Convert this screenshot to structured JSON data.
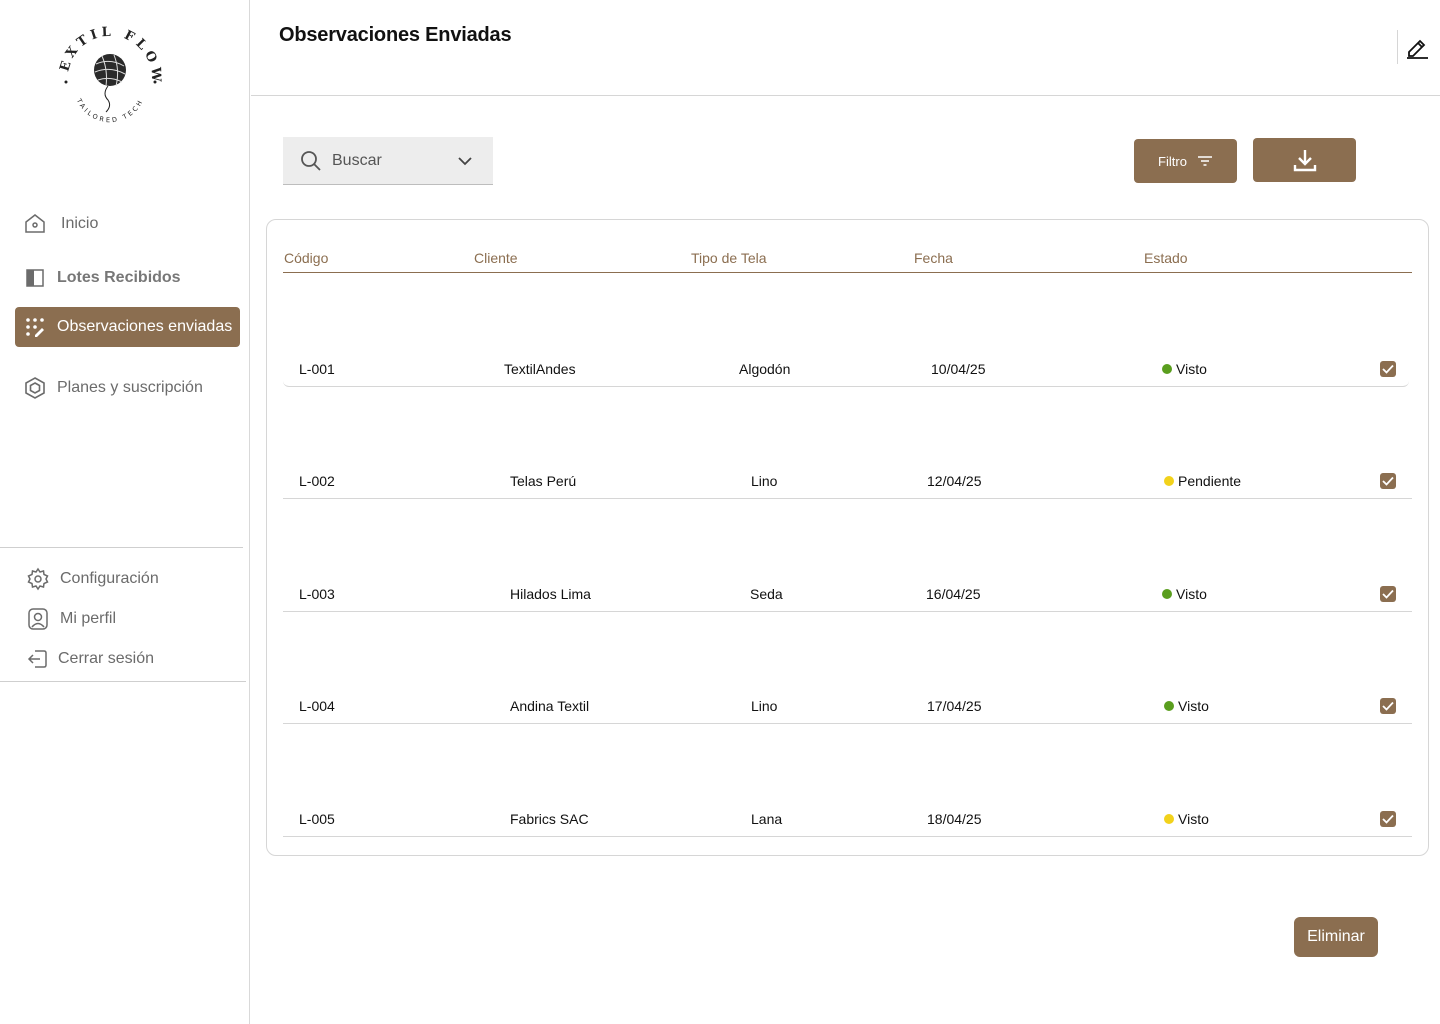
{
  "brand": {
    "logo_text": "TEXTIL FLOW",
    "logo_tagline": "TAILORED TECH"
  },
  "sidebar": {
    "items": [
      {
        "label": "Inicio",
        "icon": "home-icon"
      },
      {
        "label": "Lotes Recibidos",
        "icon": "book-icon"
      },
      {
        "label": "Observaciones enviadas",
        "icon": "dots-edit-icon",
        "active": true
      },
      {
        "label": "Planes y suscripción",
        "icon": "hexagon-icon"
      }
    ],
    "bottom_items": [
      {
        "label": "Configuración",
        "icon": "gear-icon"
      },
      {
        "label": "Mi perfil",
        "icon": "user-icon"
      },
      {
        "label": "Cerrar sesión",
        "icon": "logout-icon"
      }
    ]
  },
  "header": {
    "title": "Observaciones Enviadas"
  },
  "toolbar": {
    "search_placeholder": "Buscar",
    "filter_label": "Filtro"
  },
  "table": {
    "columns": [
      "Código",
      "Cliente",
      "Tipo de Tela",
      "Fecha",
      "Estado"
    ],
    "rows": [
      {
        "code": "L-001",
        "client": "TextilAndes",
        "fabric": "Algodón",
        "date": "10/04/25",
        "status": "Visto",
        "status_color": "#5a9e1e",
        "checked": true
      },
      {
        "code": "L-002",
        "client": "Telas Perú",
        "fabric": "Lino",
        "date": "12/04/25",
        "status": "Pendiente",
        "status_color": "#f2d21b",
        "checked": true
      },
      {
        "code": "L-003",
        "client": "Hilados Lima",
        "fabric": "Seda",
        "date": "16/04/25",
        "status": "Visto",
        "status_color": "#5a9e1e",
        "checked": true
      },
      {
        "code": "L-004",
        "client": "Andina Textil",
        "fabric": "Lino",
        "date": "17/04/25",
        "status": "Visto",
        "status_color": "#5a9e1e",
        "checked": true
      },
      {
        "code": "L-005",
        "client": "Fabrics SAC",
        "fabric": "Lana",
        "date": "18/04/25",
        "status": "Visto",
        "status_color": "#f2d21b",
        "checked": true
      }
    ]
  },
  "actions": {
    "delete_label": "Eliminar"
  },
  "colors": {
    "accent": "#8b6e50",
    "status_green": "#5a9e1e",
    "status_yellow": "#f2d21b"
  }
}
